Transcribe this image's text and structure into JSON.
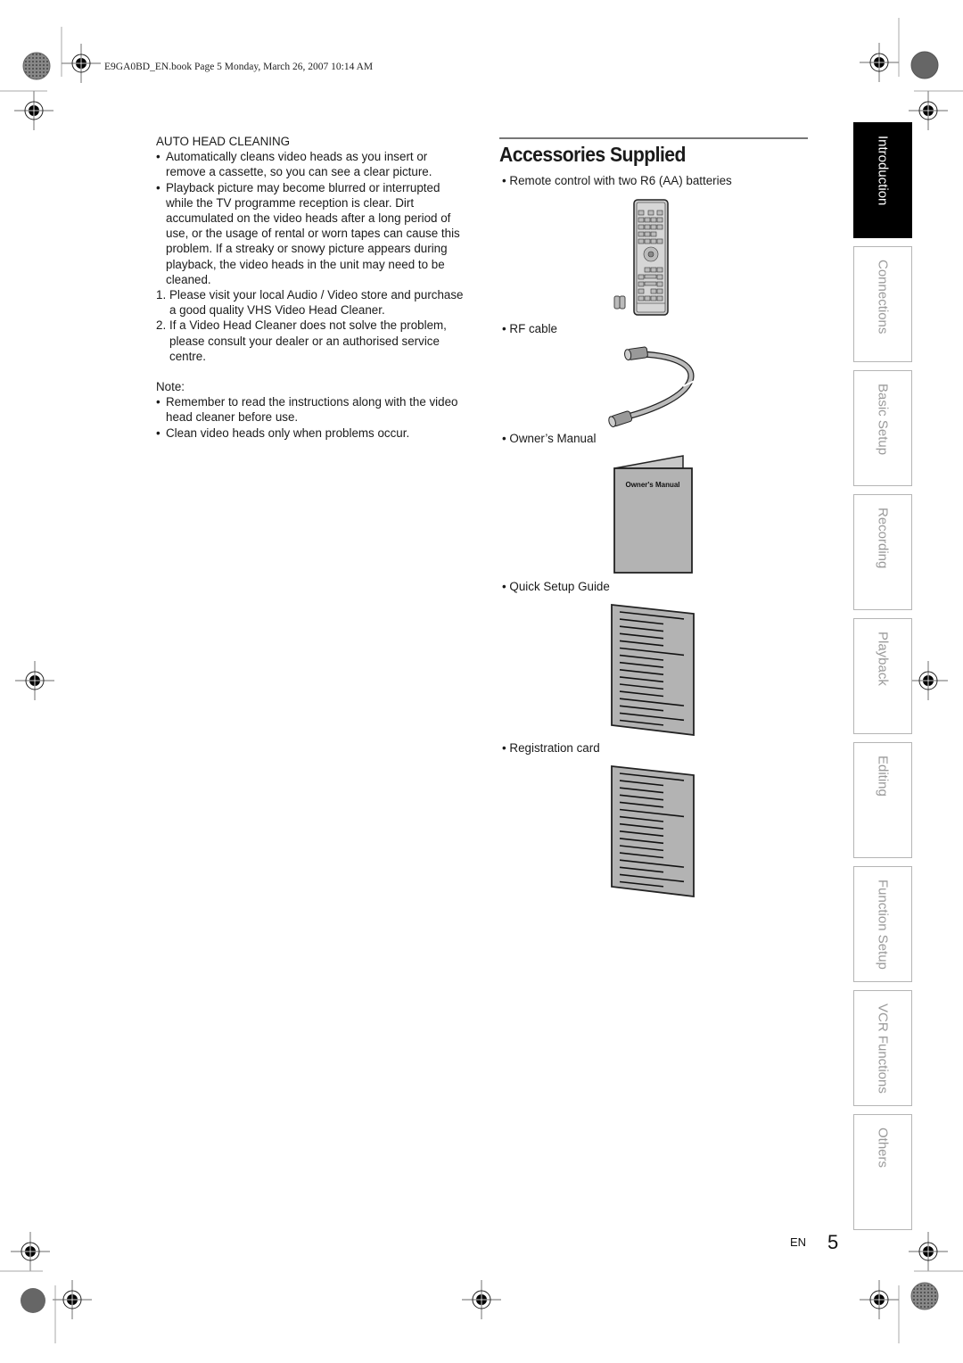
{
  "header": {
    "file_info": "E9GA0BD_EN.book  Page 5  Monday, March 26, 2007  10:14 AM"
  },
  "auto_head_cleaning": {
    "heading": "AUTO HEAD CLEANING",
    "bullets": [
      "Automatically cleans video heads as you insert or remove a cassette, so you can see a clear picture.",
      "Playback picture may become blurred or interrupted while the TV programme reception is clear. Dirt accumulated on the video heads after a long period of use, or the usage of rental or worn tapes can cause this problem. If a streaky or snowy picture appears during playback, the video heads in the unit may need to be cleaned."
    ],
    "steps": [
      {
        "n": "1.",
        "text": "Please visit your local Audio / Video store and purchase a good quality VHS Video Head Cleaner."
      },
      {
        "n": "2.",
        "text": "If a Video Head Cleaner does not solve the problem, please consult your dealer or an authorised service centre."
      }
    ],
    "note_label": "Note:",
    "notes": [
      "Remember to read the instructions along with the video head cleaner before use.",
      "Clean video heads only when problems occur."
    ]
  },
  "accessories": {
    "title": "Accessories Supplied",
    "items": [
      {
        "label": "Remote control with two R6 (AA) batteries",
        "icon": "remote-control-icon"
      },
      {
        "label": "RF cable",
        "icon": "rf-cable-icon"
      },
      {
        "label": "Owner’s Manual",
        "icon": "owners-manual-icon",
        "cover_text": "Owner's Manual"
      },
      {
        "label": "Quick Setup Guide",
        "icon": "quick-setup-guide-icon"
      },
      {
        "label": "Registration card",
        "icon": "registration-card-icon"
      }
    ]
  },
  "side_tabs": [
    {
      "label": "Introduction",
      "active": true
    },
    {
      "label": "Connections",
      "active": false
    },
    {
      "label": "Basic Setup",
      "active": false
    },
    {
      "label": "Recording",
      "active": false
    },
    {
      "label": "Playback",
      "active": false
    },
    {
      "label": "Editing",
      "active": false
    },
    {
      "label": "Function Setup",
      "active": false
    },
    {
      "label": "VCR Functions",
      "active": false
    },
    {
      "label": "Others",
      "active": false
    }
  ],
  "footer": {
    "language": "EN",
    "page_number": "5"
  },
  "colors": {
    "active_tab_bg": "#000000",
    "inactive_tab_text": "#9a9a9a",
    "illustration_gray": "#b3b3b3"
  }
}
